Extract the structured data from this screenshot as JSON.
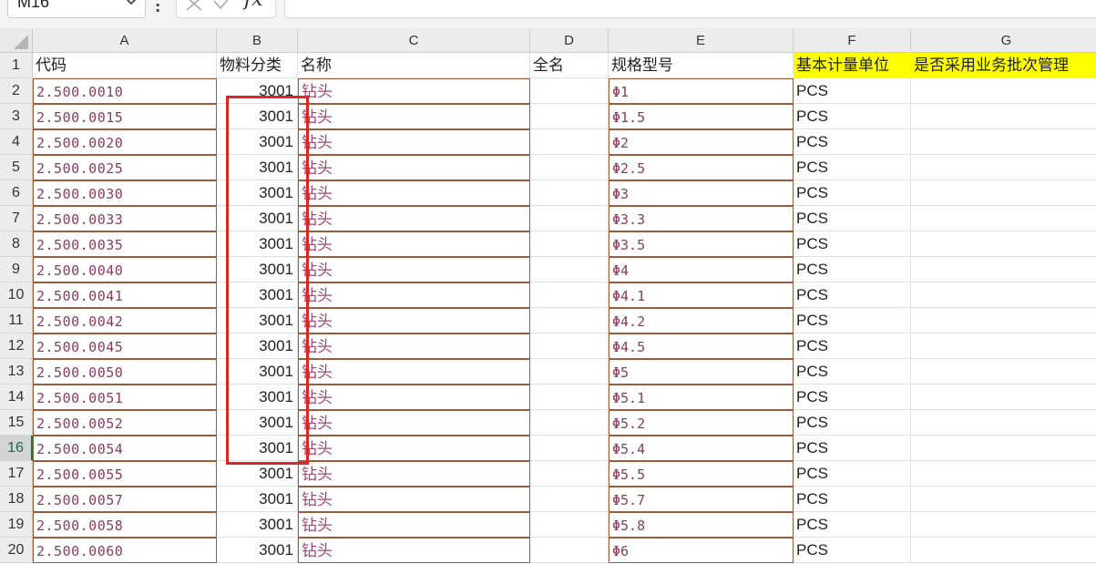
{
  "formula_bar": {
    "name_box": "M16",
    "separator": ":",
    "fx_label": "fx",
    "formula": ""
  },
  "columns": [
    "A",
    "B",
    "C",
    "D",
    "E",
    "F",
    "G"
  ],
  "header_row": {
    "row_number": "1",
    "A": "代码",
    "B": "物料分类",
    "C": "名称",
    "D": "全名",
    "E": "规格型号",
    "F": "基本计量单位",
    "G": "是否采用业务批次管理"
  },
  "rows": [
    {
      "n": "2",
      "code": "2.500.0010",
      "cat": "3001",
      "name": "钻头",
      "spec": "Φ1",
      "unit": "PCS"
    },
    {
      "n": "3",
      "code": "2.500.0015",
      "cat": "3001",
      "name": "钻头",
      "spec": "Φ1.5",
      "unit": "PCS"
    },
    {
      "n": "4",
      "code": "2.500.0020",
      "cat": "3001",
      "name": "钻头",
      "spec": "Φ2",
      "unit": "PCS"
    },
    {
      "n": "5",
      "code": "2.500.0025",
      "cat": "3001",
      "name": "钻头",
      "spec": "Φ2.5",
      "unit": "PCS"
    },
    {
      "n": "6",
      "code": "2.500.0030",
      "cat": "3001",
      "name": "钻头",
      "spec": "Φ3",
      "unit": "PCS"
    },
    {
      "n": "7",
      "code": "2.500.0033",
      "cat": "3001",
      "name": "钻头",
      "spec": "Φ3.3",
      "unit": "PCS"
    },
    {
      "n": "8",
      "code": "2.500.0035",
      "cat": "3001",
      "name": "钻头",
      "spec": "Φ3.5",
      "unit": "PCS"
    },
    {
      "n": "9",
      "code": "2.500.0040",
      "cat": "3001",
      "name": "钻头",
      "spec": "Φ4",
      "unit": "PCS"
    },
    {
      "n": "10",
      "code": "2.500.0041",
      "cat": "3001",
      "name": "钻头",
      "spec": "Φ4.1",
      "unit": "PCS"
    },
    {
      "n": "11",
      "code": "2.500.0042",
      "cat": "3001",
      "name": "钻头",
      "spec": "Φ4.2",
      "unit": "PCS"
    },
    {
      "n": "12",
      "code": "2.500.0045",
      "cat": "3001",
      "name": "钻头",
      "spec": "Φ4.5",
      "unit": "PCS"
    },
    {
      "n": "13",
      "code": "2.500.0050",
      "cat": "3001",
      "name": "钻头",
      "spec": "Φ5",
      "unit": "PCS"
    },
    {
      "n": "14",
      "code": "2.500.0051",
      "cat": "3001",
      "name": "钻头",
      "spec": "Φ5.1",
      "unit": "PCS"
    },
    {
      "n": "15",
      "code": "2.500.0052",
      "cat": "3001",
      "name": "钻头",
      "spec": "Φ5.2",
      "unit": "PCS"
    },
    {
      "n": "16",
      "code": "2.500.0054",
      "cat": "3001",
      "name": "钻头",
      "spec": "Φ5.4",
      "unit": "PCS"
    },
    {
      "n": "17",
      "code": "2.500.0055",
      "cat": "3001",
      "name": "钻头",
      "spec": "Φ5.5",
      "unit": "PCS"
    },
    {
      "n": "18",
      "code": "2.500.0057",
      "cat": "3001",
      "name": "钻头",
      "spec": "Φ5.7",
      "unit": "PCS"
    },
    {
      "n": "19",
      "code": "2.500.0058",
      "cat": "3001",
      "name": "钻头",
      "spec": "Φ5.8",
      "unit": "PCS"
    },
    {
      "n": "20",
      "code": "2.500.0060",
      "cat": "3001",
      "name": "钻头",
      "spec": "Φ6",
      "unit": "PCS"
    }
  ],
  "active_row": "16",
  "colors": {
    "header_highlight": "#ffff00",
    "selection_box": "#e02424",
    "text_accent": "#8b3a62"
  },
  "icons": {
    "name_box_dropdown": "chevron-down-icon",
    "cancel": "close-icon",
    "confirm": "check-icon"
  }
}
